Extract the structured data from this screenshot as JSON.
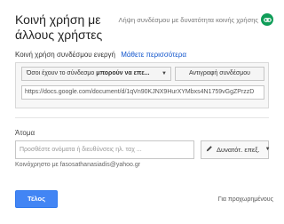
{
  "dialog": {
    "title": "Κοινή χρήση με άλλους χρήστες"
  },
  "get_link": {
    "label": "Λήψη συνδέσμου με δυνατότητα κοινής χρήσης",
    "icon": "link-icon",
    "icon_color": "#0f9d58"
  },
  "link_sharing": {
    "status": "Κοινή χρήση συνδέσμου ενεργή",
    "learn_more": "Μάθετε περισσότερα",
    "access_prefix": "Όσοι έχουν το σύνδεσμο",
    "access_bold": "μπορούν να επε...",
    "copy_button": "Αντιγραφή συνδέσμου",
    "url": "https://docs.google.com/document/d/1qVn90KJNX9HurXYMbxs4N1759vGgZPrzzD"
  },
  "people": {
    "label": "Άτομα",
    "placeholder": "Προσθέστε ονόματα ή διευθύνσεις ηλ. ταχ ...",
    "permission_label": "Δυνατότ. επεξ.",
    "owner_text": "Κοινόχρηστο με fasosathanasiadis@yahoo.gr"
  },
  "footer": {
    "done_button": "Τέλος",
    "accent": "#4285f4",
    "advanced_link": "Για προχωρημένους"
  }
}
